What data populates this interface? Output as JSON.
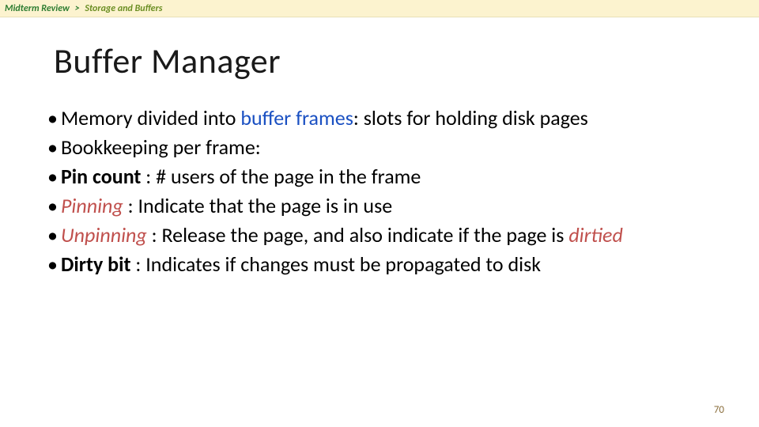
{
  "breadcrumb": {
    "root": "Midterm Review",
    "separator": ">",
    "leaf": "Storage and Buffers"
  },
  "title": "Buffer Manager",
  "bullets": {
    "l0a_pre": "Memory divided into ",
    "l0a_kw": "buffer frames",
    "l0a_post": ": slots for holding disk pages",
    "l0b": "Bookkeeping per frame:",
    "l1a_strong": "Pin count",
    "l1a_rest": " : # users of the page in the frame",
    "l2a_em": "Pinning",
    "l2a_rest": " : Indicate that the page is in use",
    "l2b_em": "Unpinning",
    "l2b_mid": " : Release the page, and also indicate if the page is ",
    "l2b_em2": "dirtied",
    "l1b_strong": "Dirty bit",
    "l1b_rest": " : Indicates if changes must be propagated to disk"
  },
  "page_number": "70",
  "glyphs": {
    "bullet": "•"
  }
}
